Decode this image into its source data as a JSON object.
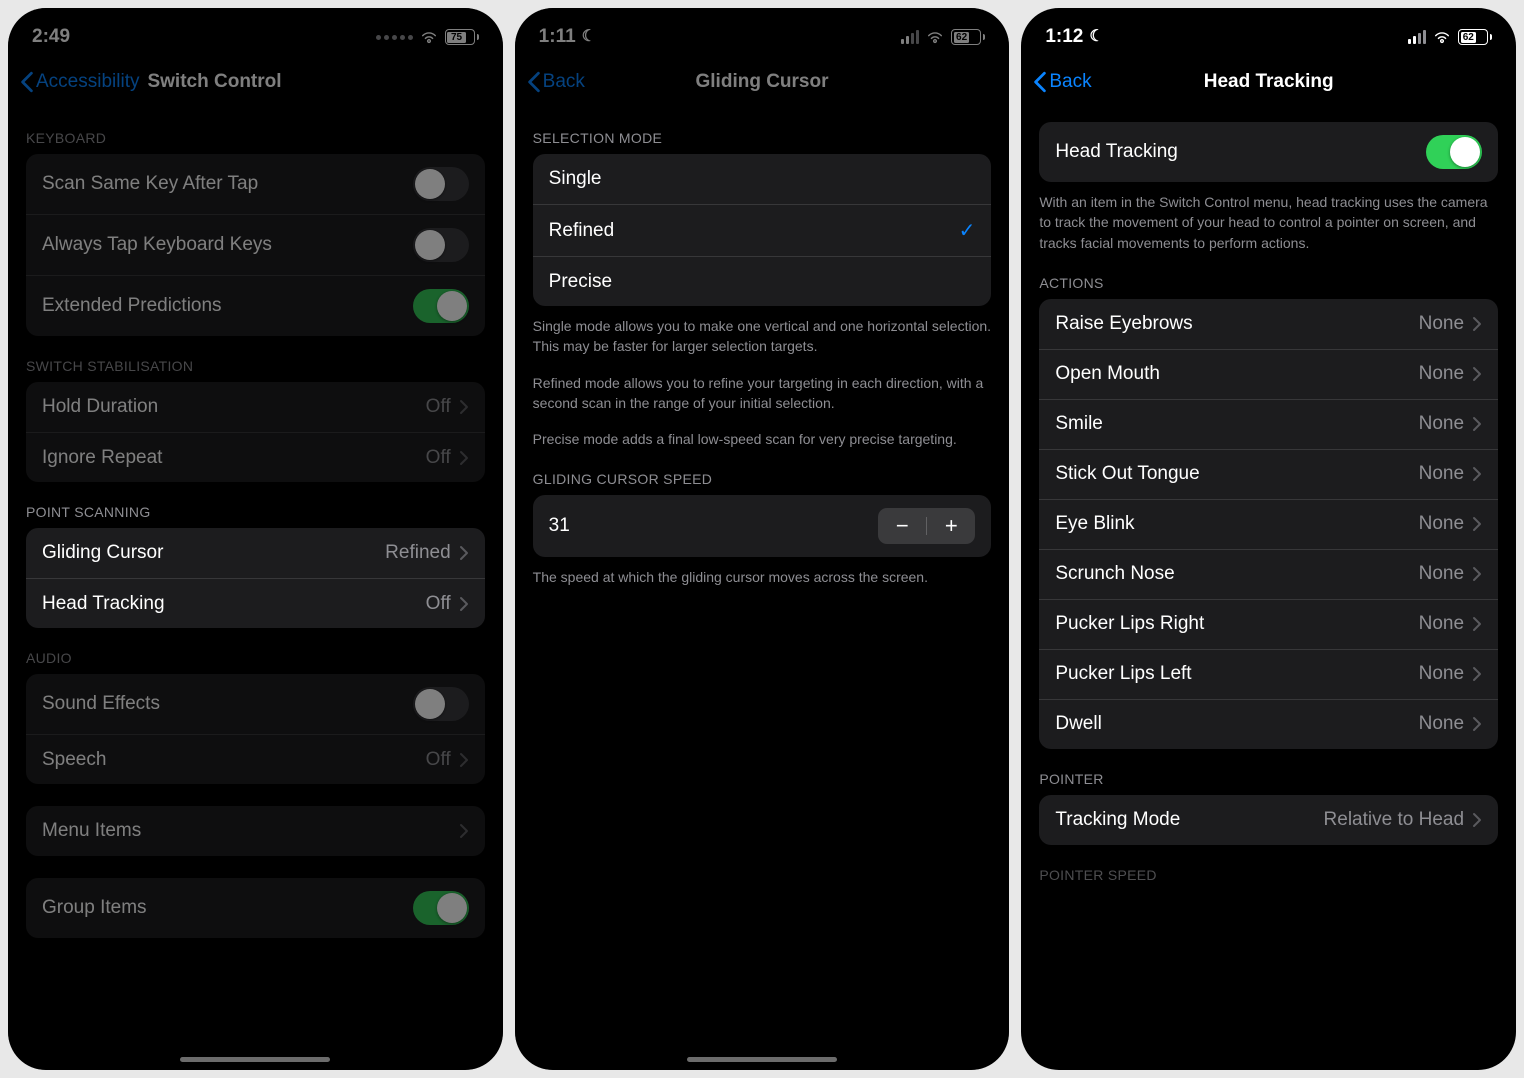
{
  "phone1": {
    "status": {
      "time": "2:49",
      "battery": "75",
      "battery_pct": 75
    },
    "nav": {
      "back_label": "Accessibility",
      "title": "Switch Control"
    },
    "sections": {
      "keyboard": {
        "header": "KEYBOARD",
        "rows": [
          {
            "label": "Scan Same Key After Tap",
            "toggle": false
          },
          {
            "label": "Always Tap Keyboard Keys",
            "toggle": false
          },
          {
            "label": "Extended Predictions",
            "toggle": true
          }
        ]
      },
      "switch_stabilisation": {
        "header": "SWITCH STABILISATION",
        "rows": [
          {
            "label": "Hold Duration",
            "value": "Off"
          },
          {
            "label": "Ignore Repeat",
            "value": "Off"
          }
        ]
      },
      "point_scanning": {
        "header": "POINT SCANNING",
        "rows": [
          {
            "label": "Gliding Cursor",
            "value": "Refined"
          },
          {
            "label": "Head Tracking",
            "value": "Off"
          }
        ]
      },
      "audio": {
        "header": "AUDIO",
        "rows": [
          {
            "label": "Sound Effects",
            "toggle": false
          },
          {
            "label": "Speech",
            "value": "Off"
          }
        ]
      },
      "menu": {
        "rows": [
          {
            "label": "Menu Items"
          }
        ]
      },
      "group_items": {
        "rows": [
          {
            "label": "Group Items",
            "toggle": true
          }
        ]
      }
    }
  },
  "phone2": {
    "status": {
      "time": "1:11",
      "battery": "62",
      "battery_pct": 62
    },
    "nav": {
      "back_label": "Back",
      "title": "Gliding Cursor"
    },
    "selection_mode": {
      "header": "SELECTION MODE",
      "options": [
        {
          "label": "Single",
          "selected": false
        },
        {
          "label": "Refined",
          "selected": true
        },
        {
          "label": "Precise",
          "selected": false
        }
      ],
      "footer1": "Single mode allows you to make one vertical and one horizontal selection. This may be faster for larger selection targets.",
      "footer2": "Refined mode allows you to refine your targeting in each direction, with a second scan in the range of your initial selection.",
      "footer3": "Precise mode adds a final low-speed scan for very precise targeting."
    },
    "speed": {
      "header": "GLIDING CURSOR SPEED",
      "value": "31",
      "footer": "The speed at which the gliding cursor moves across the screen."
    }
  },
  "phone3": {
    "status": {
      "time": "1:12",
      "battery": "62",
      "battery_pct": 62
    },
    "nav": {
      "back_label": "Back",
      "title": "Head Tracking"
    },
    "main_toggle": {
      "label": "Head Tracking",
      "on": true,
      "footer": "With an item in the Switch Control menu, head tracking uses the camera to track the movement of your head to control a pointer on screen, and tracks facial movements to perform actions."
    },
    "actions": {
      "header": "ACTIONS",
      "rows": [
        {
          "label": "Raise Eyebrows",
          "value": "None"
        },
        {
          "label": "Open Mouth",
          "value": "None"
        },
        {
          "label": "Smile",
          "value": "None"
        },
        {
          "label": "Stick Out Tongue",
          "value": "None"
        },
        {
          "label": "Eye Blink",
          "value": "None"
        },
        {
          "label": "Scrunch Nose",
          "value": "None"
        },
        {
          "label": "Pucker Lips Right",
          "value": "None"
        },
        {
          "label": "Pucker Lips Left",
          "value": "None"
        },
        {
          "label": "Dwell",
          "value": "None"
        }
      ]
    },
    "pointer": {
      "header": "POINTER",
      "rows": [
        {
          "label": "Tracking Mode",
          "value": "Relative to Head"
        }
      ]
    },
    "pointer_speed_header": "POINTER SPEED"
  }
}
